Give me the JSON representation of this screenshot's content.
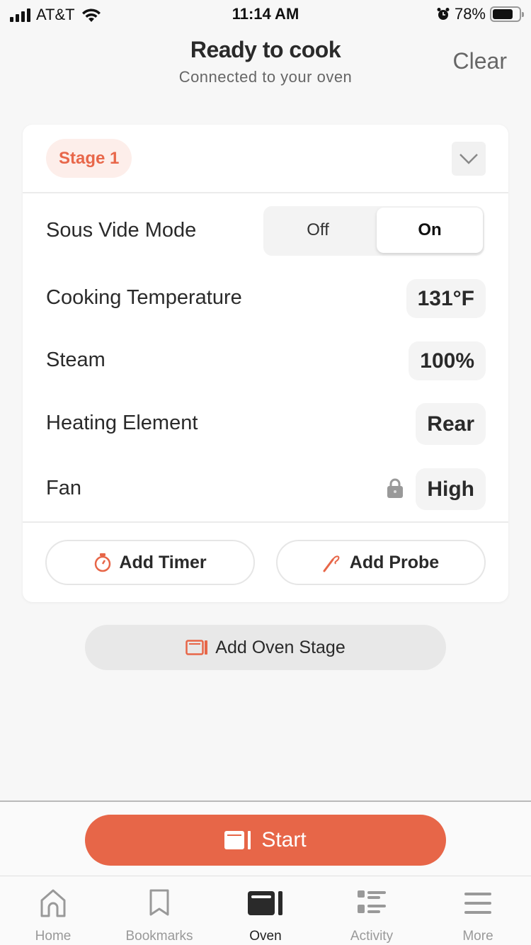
{
  "status_bar": {
    "carrier": "AT&T",
    "time": "11:14 AM",
    "battery": "78%",
    "battery_level": 0.78
  },
  "header": {
    "title": "Ready to cook",
    "subtitle": "Connected to your oven",
    "clear_label": "Clear"
  },
  "stage": {
    "label": "Stage 1",
    "sous_vide": {
      "label": "Sous Vide Mode",
      "options": [
        "Off",
        "On"
      ],
      "selected": "On"
    },
    "settings": [
      {
        "label": "Cooking Temperature",
        "value": "131°F"
      },
      {
        "label": "Steam",
        "value": "100%"
      },
      {
        "label": "Heating Element",
        "value": "Rear"
      },
      {
        "label": "Fan",
        "value": "High",
        "locked": true
      }
    ],
    "add_timer_label": "Add Timer",
    "add_probe_label": "Add Probe"
  },
  "add_stage_label": "Add Oven Stage",
  "start_label": "Start",
  "colors": {
    "accent": "#e76648",
    "accent_light": "#fdeeea"
  },
  "tabs": [
    {
      "label": "Home",
      "icon": "home-icon",
      "active": false
    },
    {
      "label": "Bookmarks",
      "icon": "bookmark-icon",
      "active": false
    },
    {
      "label": "Oven",
      "icon": "oven-icon",
      "active": true
    },
    {
      "label": "Activity",
      "icon": "activity-icon",
      "active": false
    },
    {
      "label": "More",
      "icon": "menu-icon",
      "active": false
    }
  ]
}
